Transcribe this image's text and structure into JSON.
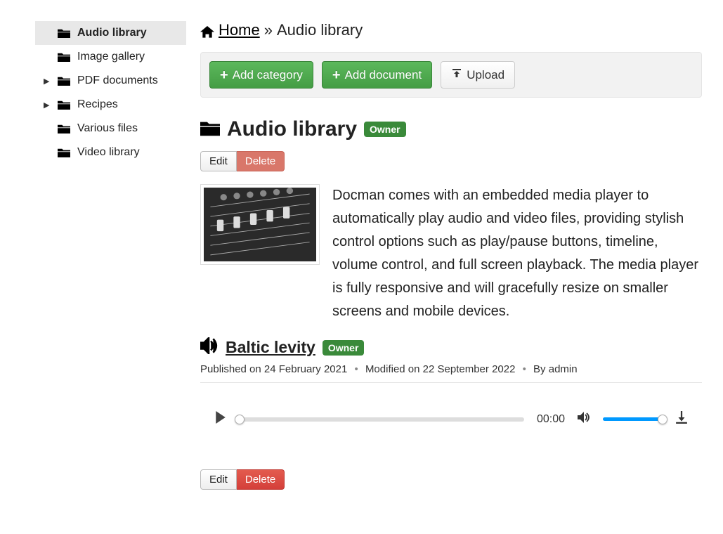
{
  "sidebar": {
    "items": [
      {
        "label": "Audio library",
        "has_children": false,
        "active": true
      },
      {
        "label": "Image gallery",
        "has_children": false,
        "active": false
      },
      {
        "label": "PDF documents",
        "has_children": true,
        "active": false
      },
      {
        "label": "Recipes",
        "has_children": true,
        "active": false
      },
      {
        "label": "Various files",
        "has_children": false,
        "active": false
      },
      {
        "label": "Video library",
        "has_children": false,
        "active": false
      }
    ]
  },
  "breadcrumb": {
    "home": "Home",
    "separator": "»",
    "current": "Audio library"
  },
  "toolbar": {
    "add_category": "Add category",
    "add_document": "Add document",
    "upload": "Upload"
  },
  "page": {
    "title": "Audio library",
    "owner_badge": "Owner",
    "edit": "Edit",
    "delete": "Delete",
    "description": "Docman comes with an embedded media player to automatically play audio and video files, providing stylish control options such as play/pause buttons, timeline, volume control, and full screen playback. The media player is fully responsive and will gracefully resize on smaller screens and mobile devices."
  },
  "document": {
    "title": "Baltic levity",
    "owner_badge": "Owner",
    "published_label": "Published on",
    "published_date": "24 February 2021",
    "modified_label": "Modified on",
    "modified_date": "22 September 2022",
    "by_label": "By",
    "author": "admin",
    "edit": "Edit",
    "delete": "Delete"
  },
  "player": {
    "time": "00:00"
  }
}
